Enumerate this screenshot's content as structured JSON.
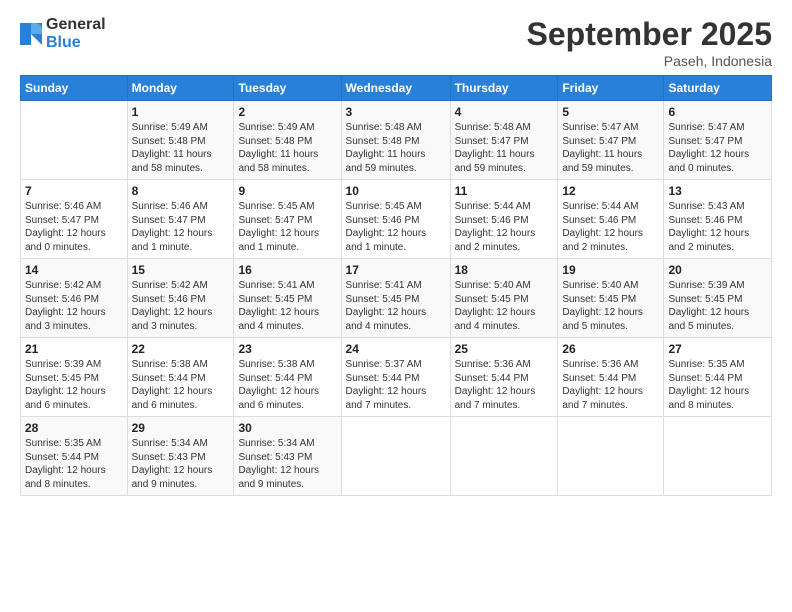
{
  "header": {
    "logo_general": "General",
    "logo_blue": "Blue",
    "title": "September 2025",
    "location": "Paseh, Indonesia"
  },
  "weekdays": [
    "Sunday",
    "Monday",
    "Tuesday",
    "Wednesday",
    "Thursday",
    "Friday",
    "Saturday"
  ],
  "weeks": [
    [
      {
        "day": "",
        "info": ""
      },
      {
        "day": "1",
        "info": "Sunrise: 5:49 AM\nSunset: 5:48 PM\nDaylight: 11 hours\nand 58 minutes."
      },
      {
        "day": "2",
        "info": "Sunrise: 5:49 AM\nSunset: 5:48 PM\nDaylight: 11 hours\nand 58 minutes."
      },
      {
        "day": "3",
        "info": "Sunrise: 5:48 AM\nSunset: 5:48 PM\nDaylight: 11 hours\nand 59 minutes."
      },
      {
        "day": "4",
        "info": "Sunrise: 5:48 AM\nSunset: 5:47 PM\nDaylight: 11 hours\nand 59 minutes."
      },
      {
        "day": "5",
        "info": "Sunrise: 5:47 AM\nSunset: 5:47 PM\nDaylight: 11 hours\nand 59 minutes."
      },
      {
        "day": "6",
        "info": "Sunrise: 5:47 AM\nSunset: 5:47 PM\nDaylight: 12 hours\nand 0 minutes."
      }
    ],
    [
      {
        "day": "7",
        "info": "Sunrise: 5:46 AM\nSunset: 5:47 PM\nDaylight: 12 hours\nand 0 minutes."
      },
      {
        "day": "8",
        "info": "Sunrise: 5:46 AM\nSunset: 5:47 PM\nDaylight: 12 hours\nand 1 minute."
      },
      {
        "day": "9",
        "info": "Sunrise: 5:45 AM\nSunset: 5:47 PM\nDaylight: 12 hours\nand 1 minute."
      },
      {
        "day": "10",
        "info": "Sunrise: 5:45 AM\nSunset: 5:46 PM\nDaylight: 12 hours\nand 1 minute."
      },
      {
        "day": "11",
        "info": "Sunrise: 5:44 AM\nSunset: 5:46 PM\nDaylight: 12 hours\nand 2 minutes."
      },
      {
        "day": "12",
        "info": "Sunrise: 5:44 AM\nSunset: 5:46 PM\nDaylight: 12 hours\nand 2 minutes."
      },
      {
        "day": "13",
        "info": "Sunrise: 5:43 AM\nSunset: 5:46 PM\nDaylight: 12 hours\nand 2 minutes."
      }
    ],
    [
      {
        "day": "14",
        "info": "Sunrise: 5:42 AM\nSunset: 5:46 PM\nDaylight: 12 hours\nand 3 minutes."
      },
      {
        "day": "15",
        "info": "Sunrise: 5:42 AM\nSunset: 5:46 PM\nDaylight: 12 hours\nand 3 minutes."
      },
      {
        "day": "16",
        "info": "Sunrise: 5:41 AM\nSunset: 5:45 PM\nDaylight: 12 hours\nand 4 minutes."
      },
      {
        "day": "17",
        "info": "Sunrise: 5:41 AM\nSunset: 5:45 PM\nDaylight: 12 hours\nand 4 minutes."
      },
      {
        "day": "18",
        "info": "Sunrise: 5:40 AM\nSunset: 5:45 PM\nDaylight: 12 hours\nand 4 minutes."
      },
      {
        "day": "19",
        "info": "Sunrise: 5:40 AM\nSunset: 5:45 PM\nDaylight: 12 hours\nand 5 minutes."
      },
      {
        "day": "20",
        "info": "Sunrise: 5:39 AM\nSunset: 5:45 PM\nDaylight: 12 hours\nand 5 minutes."
      }
    ],
    [
      {
        "day": "21",
        "info": "Sunrise: 5:39 AM\nSunset: 5:45 PM\nDaylight: 12 hours\nand 6 minutes."
      },
      {
        "day": "22",
        "info": "Sunrise: 5:38 AM\nSunset: 5:44 PM\nDaylight: 12 hours\nand 6 minutes."
      },
      {
        "day": "23",
        "info": "Sunrise: 5:38 AM\nSunset: 5:44 PM\nDaylight: 12 hours\nand 6 minutes."
      },
      {
        "day": "24",
        "info": "Sunrise: 5:37 AM\nSunset: 5:44 PM\nDaylight: 12 hours\nand 7 minutes."
      },
      {
        "day": "25",
        "info": "Sunrise: 5:36 AM\nSunset: 5:44 PM\nDaylight: 12 hours\nand 7 minutes."
      },
      {
        "day": "26",
        "info": "Sunrise: 5:36 AM\nSunset: 5:44 PM\nDaylight: 12 hours\nand 7 minutes."
      },
      {
        "day": "27",
        "info": "Sunrise: 5:35 AM\nSunset: 5:44 PM\nDaylight: 12 hours\nand 8 minutes."
      }
    ],
    [
      {
        "day": "28",
        "info": "Sunrise: 5:35 AM\nSunset: 5:44 PM\nDaylight: 12 hours\nand 8 minutes."
      },
      {
        "day": "29",
        "info": "Sunrise: 5:34 AM\nSunset: 5:43 PM\nDaylight: 12 hours\nand 9 minutes."
      },
      {
        "day": "30",
        "info": "Sunrise: 5:34 AM\nSunset: 5:43 PM\nDaylight: 12 hours\nand 9 minutes."
      },
      {
        "day": "",
        "info": ""
      },
      {
        "day": "",
        "info": ""
      },
      {
        "day": "",
        "info": ""
      },
      {
        "day": "",
        "info": ""
      }
    ]
  ]
}
